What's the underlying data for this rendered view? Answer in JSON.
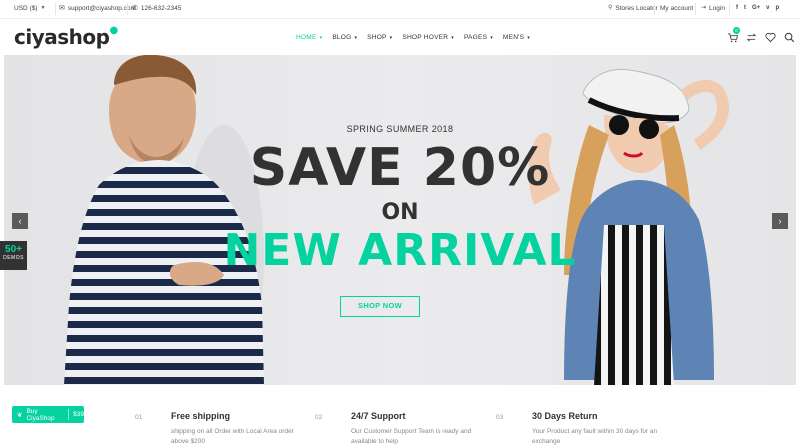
{
  "topbar": {
    "currency": "USD ($)",
    "email": "support@ciyashop.com",
    "phone": "126-632-2345",
    "stores_locator": "Stores Locator",
    "my_account": "My account",
    "login": "Login"
  },
  "header": {
    "logo": "ciyashop",
    "nav": [
      {
        "label": "HOME",
        "active": true
      },
      {
        "label": "BLOG"
      },
      {
        "label": "SHOP"
      },
      {
        "label": "SHOP HOVER"
      },
      {
        "label": "PAGES"
      },
      {
        "label": "MEN'S"
      }
    ],
    "cart_count": "0"
  },
  "hero": {
    "kicker": "SPRING SUMMER 2018",
    "headline": "SAVE 20%",
    "on": "ON",
    "subheadline": "NEW ARRIVAL",
    "cta": "SHOP NOW"
  },
  "demos": {
    "count": "50+",
    "label": "DEMOS"
  },
  "features": [
    {
      "num": "01",
      "title": "Free shipping",
      "desc": "shipping on all Order with Local Area order above $200"
    },
    {
      "num": "02",
      "title": "24/7 Support",
      "desc": "Our Customer Support Team is ready and available to help"
    },
    {
      "num": "03",
      "title": "30 Days Return",
      "desc": "Your Product any fault within 30 days for an exchange"
    }
  ],
  "buy": {
    "label": "Buy CiyaShop",
    "price": "$39"
  },
  "colors": {
    "accent": "#04d39f",
    "dark": "#323232"
  }
}
